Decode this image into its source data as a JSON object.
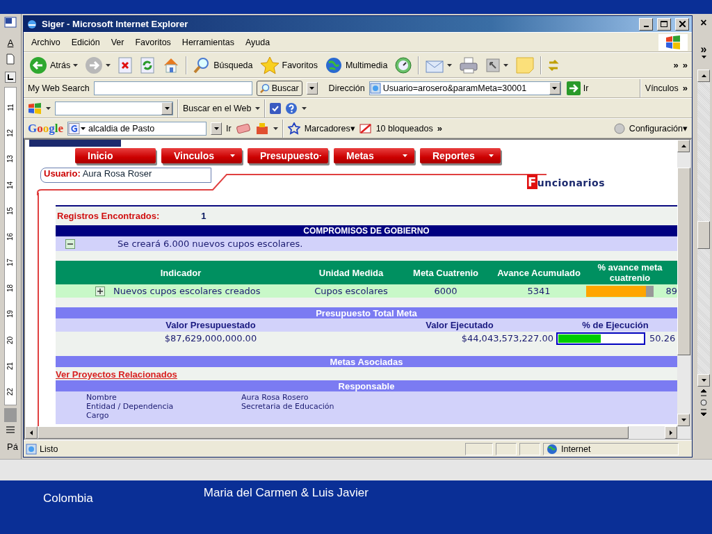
{
  "word": {
    "format_label": "A",
    "ruler_labels": [
      "11",
      "12",
      "13",
      "14",
      "15",
      "16",
      "17",
      "18",
      "19",
      "20",
      "21",
      "22"
    ],
    "status_text": "Pá",
    "right_labels": [
      "×",
      "»"
    ]
  },
  "browser": {
    "title": "Siger - Microsoft Internet Explorer",
    "menu": [
      "Archivo",
      "Edición",
      "Ver",
      "Favoritos",
      "Herramientas",
      "Ayuda"
    ],
    "toolbar": [
      {
        "kind": "back",
        "label": "Atrás",
        "menu": true
      },
      {
        "kind": "forward",
        "menu": true
      },
      {
        "kind": "stop",
        "menu": false
      },
      {
        "kind": "refresh",
        "menu": false
      },
      {
        "kind": "home",
        "menu": false
      },
      {
        "kind": "separator"
      },
      {
        "kind": "search",
        "label": "Búsqueda",
        "menu": false
      },
      {
        "kind": "favorites",
        "label": "Favoritos",
        "menu": false
      },
      {
        "kind": "media",
        "label": "Multimedia",
        "menu": false
      },
      {
        "kind": "history",
        "menu": false
      },
      {
        "kind": "separator"
      },
      {
        "kind": "mail",
        "menu": true
      },
      {
        "kind": "print",
        "menu": false
      },
      {
        "kind": "edit",
        "menu": true
      },
      {
        "kind": "note",
        "menu": false
      },
      {
        "kind": "separator"
      },
      {
        "kind": "sync",
        "menu": false
      }
    ],
    "toolbar_more": [
      "»",
      "»"
    ],
    "address_bar": {
      "search_label": "My Web Search",
      "search_button": "Buscar",
      "address_label": "Dirección",
      "address": "Usuario=arosero&paramMeta=30001",
      "go": "Ir",
      "links": "Vínculos",
      "more": "»"
    },
    "search_toolbar": {
      "web_search": "Buscar en el Web"
    },
    "google_bar": {
      "logo": "Google",
      "query": "alcaldia de Pasto",
      "go": "Ir",
      "bookmarks": "Marcadores▾",
      "blocked": "10 bloqueados",
      "more": "»",
      "settings": "Configuración▾"
    },
    "page": {
      "nav": [
        {
          "label": "Inicio",
          "menu": false
        },
        {
          "label": "Vinculos",
          "menu": true
        },
        {
          "label": "Presupuesto",
          "menu": true
        },
        {
          "label": "Metas",
          "menu": true
        },
        {
          "label": "Reportes",
          "menu": true
        }
      ],
      "user": "**Usuario:** Aura Rosa Roser",
      "section": "**F**uncionarios",
      "records_label": "Registros Encontrados:",
      "records_count": "1",
      "commitments_title": "COMPROMISOS DE GOBIERNO",
      "commitment": {
        "text": "Se creará 6.000 nuevos cupos escolares.",
        "expanded": true
      },
      "indicator_columns": [
        "Indicador",
        "Unidad Medida",
        "Meta Cuatrenio",
        "Avance Acumulado",
        "% avance meta cuatrenio"
      ],
      "indicator": {
        "name": "Nuevos cupos escolares creados",
        "expanded": false,
        "unit": "Cupos escolares",
        "goal": "6000",
        "progress": "5341",
        "level": 0.89,
        "percent": "89"
      },
      "budget_title": "Presupuesto Total Meta",
      "budget_columns": [
        "Valor Presupuestado",
        "Valor Ejecutado",
        "% de Ejecución"
      ],
      "budget": {
        "budgeted": "$87,629,000,000.00",
        "executed": "$44,043,573,227.00",
        "level": 0.5026,
        "percent": "50.26"
      },
      "goals_title": "Metas Asociadas",
      "projects_link": "Ver Proyectos Relacionados",
      "responsible_title": "Responsable",
      "responsible": [
        {
          "label": "Nombre",
          "value": "Aura Rosa Rosero"
        },
        {
          "label": "Entidad / Dependencia",
          "value": "Secretaria de Educación"
        },
        {
          "label": "Cargo"
        }
      ]
    },
    "status_bar": {
      "text": "Listo",
      "zone": "Internet"
    }
  },
  "slide": {
    "footer_left": "Colombia",
    "footer_center": "Maria del Carmen & Luis Javier"
  }
}
